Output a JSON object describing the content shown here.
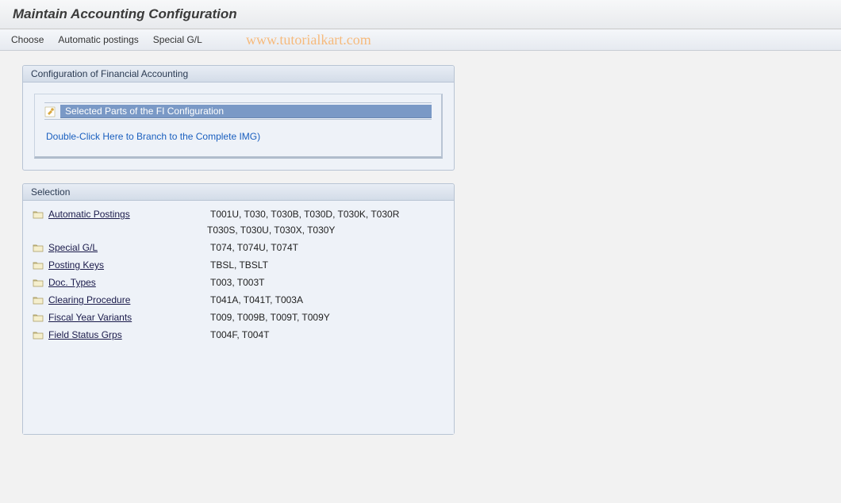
{
  "page": {
    "title": "Maintain Accounting Configuration",
    "watermark": "www.tutorialkart.com"
  },
  "toolbar": {
    "choose": "Choose",
    "auto_post": "Automatic postings",
    "special_gl": "Special G/L"
  },
  "config_group": {
    "title": "Configuration of Financial Accounting",
    "selected_parts": "Selected Parts of the FI Configuration",
    "branch_link": "Double-Click Here to Branch to the Complete IMG)"
  },
  "selection": {
    "title": "Selection",
    "rows": [
      {
        "label": "Automatic Postings",
        "tables": "T001U, T030,  T030B, T030D, T030K, T030R",
        "tables2": "T030S, T030U, T030X, T030Y"
      },
      {
        "label": "Special G/L",
        "tables": "T074,  T074U, T074T"
      },
      {
        "label": "Posting Keys",
        "tables": "TBSL,  TBSLT"
      },
      {
        "label": "Doc. Types",
        "tables": "T003,  T003T"
      },
      {
        "label": "Clearing Procedure",
        "tables": "T041A, T041T, T003A"
      },
      {
        "label": "Fiscal Year Variants",
        "tables": "T009,  T009B, T009T, T009Y"
      },
      {
        "label": "Field Status Grps",
        "tables": "T004F, T004T"
      }
    ]
  }
}
